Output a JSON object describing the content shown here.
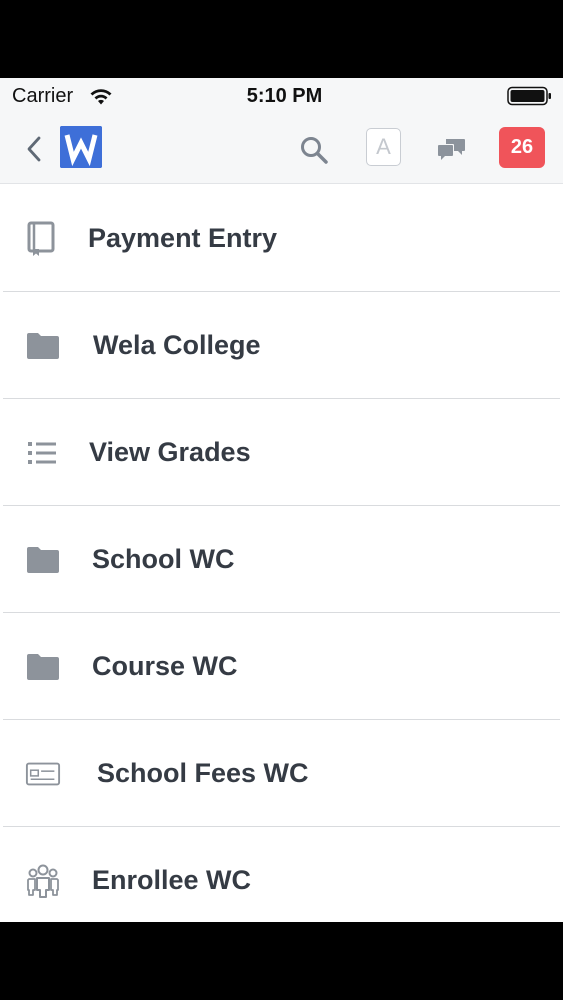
{
  "status_bar": {
    "carrier": "Carrier",
    "time": "5:10 PM"
  },
  "nav": {
    "logo_letter": "W",
    "avatar_letter": "A",
    "notification_count": "26",
    "colors": {
      "logo": "#3e6fd8",
      "badge": "#f0545a"
    }
  },
  "items": [
    {
      "label": "Payment Entry",
      "icon": "book-icon"
    },
    {
      "label": "Wela College",
      "icon": "folder-icon"
    },
    {
      "label": "View Grades",
      "icon": "list-icon"
    },
    {
      "label": "School WC",
      "icon": "folder-icon"
    },
    {
      "label": "Course WC",
      "icon": "folder-icon"
    },
    {
      "label": "School Fees WC",
      "icon": "card-icon"
    },
    {
      "label": "Enrollee WC",
      "icon": "group-icon"
    }
  ]
}
